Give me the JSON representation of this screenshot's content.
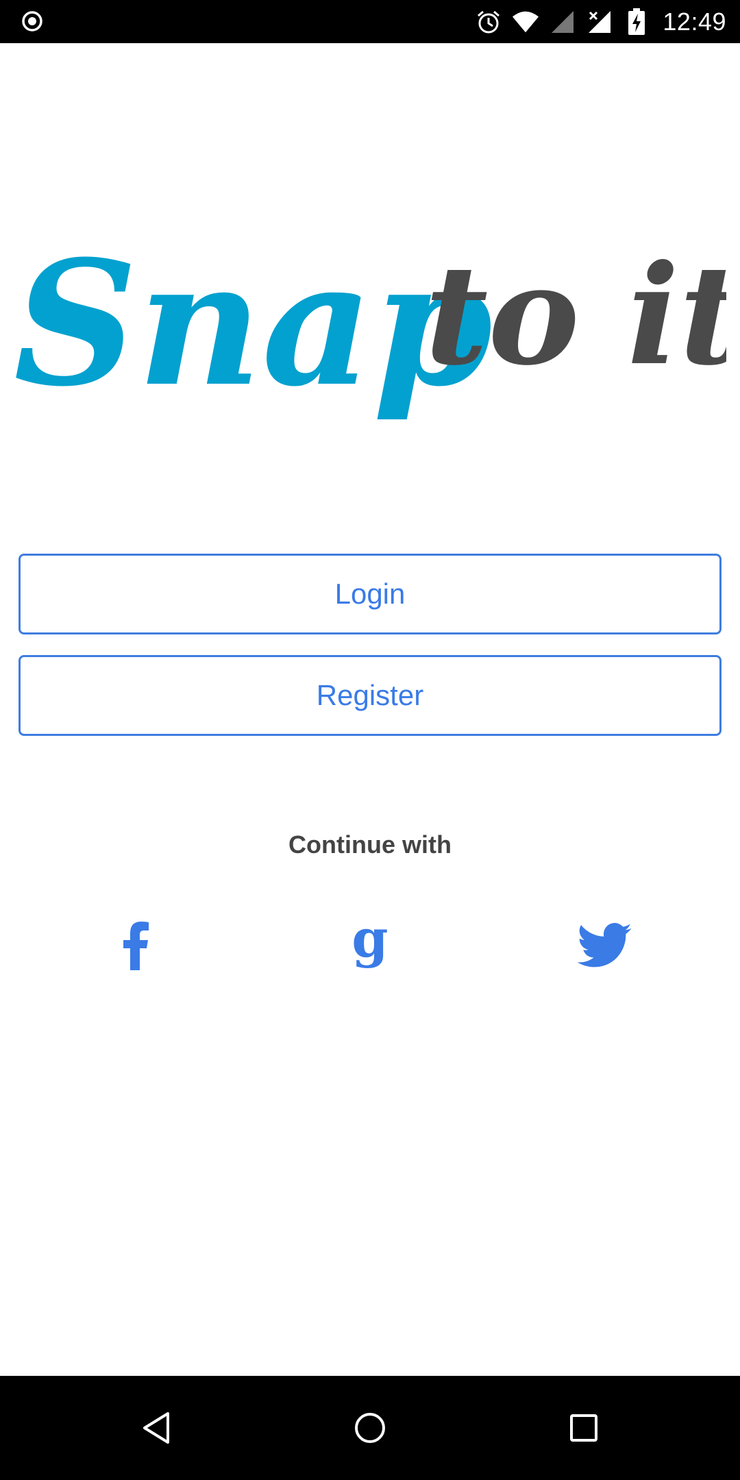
{
  "status_bar": {
    "time": "12:49",
    "icons": [
      "record-icon",
      "alarm-icon",
      "wifi-icon",
      "signal-icon",
      "no-signal-icon",
      "battery-charging-icon"
    ]
  },
  "logo": {
    "part1": "Snap",
    "part2": "to it",
    "colors": {
      "part1": "#03a1cf",
      "part2": "#4a4a4a"
    }
  },
  "buttons": {
    "login": "Login",
    "register": "Register"
  },
  "continue_with": "Continue with",
  "social": [
    {
      "name": "facebook",
      "icon": "facebook-icon"
    },
    {
      "name": "google",
      "icon": "google-icon"
    },
    {
      "name": "twitter",
      "icon": "twitter-icon"
    }
  ],
  "nav": {
    "icons": [
      "back-icon",
      "home-icon",
      "recents-icon"
    ]
  },
  "colors": {
    "accent": "#3a7be6",
    "text_dark": "#444444"
  }
}
